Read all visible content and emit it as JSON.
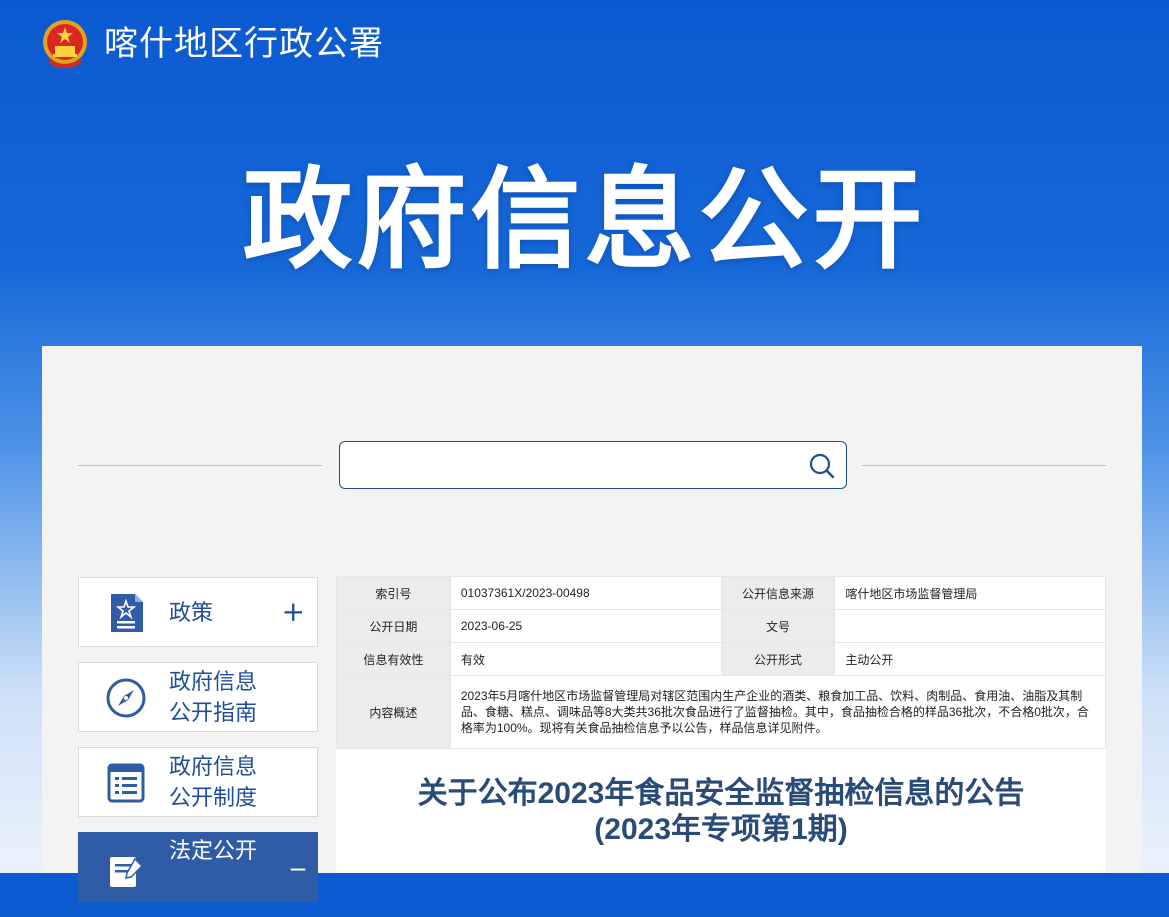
{
  "header": {
    "site_title": "喀什地区行政公署",
    "emblem_icon": "national-emblem-icon"
  },
  "hero": {
    "title": "政府信息公开"
  },
  "search": {
    "placeholder": "",
    "value": "",
    "icon": "search-icon"
  },
  "nav": {
    "items": [
      {
        "label": "政策",
        "icon": "policy-document-icon",
        "toggle": "+"
      },
      {
        "label": "政府信息\n公开指南",
        "icon": "compass-icon",
        "toggle": ""
      },
      {
        "label": "政府信息\n公开制度",
        "icon": "list-document-icon",
        "toggle": ""
      },
      {
        "label": "法定公开",
        "icon": "edit-document-icon",
        "toggle": "_"
      }
    ]
  },
  "meta": {
    "index_label": "索引号",
    "index_value": "01037361X/2023-00498",
    "source_label": "公开信息来源",
    "source_value": "喀什地区市场监督管理局",
    "date_label": "公开日期",
    "date_value": "2023-06-25",
    "docno_label": "文号",
    "docno_value": "",
    "validity_label": "信息有效性",
    "validity_value": "有效",
    "form_label": "公开形式",
    "form_value": "主动公开",
    "summary_label": "内容概述",
    "summary_value": "2023年5月喀什地区市场监督管理局对辖区范围内生产企业的酒类、粮食加工品、饮料、肉制品、食用油、油脂及其制品、食糖、糕点、调味品等8大类共36批次食品进行了监督抽检。其中，食品抽检合格的样品36批次，不合格0批次，合格率为100%。现将有关食品抽检信息予以公告，样品信息详见附件。"
  },
  "document": {
    "title_line1": "关于公布2023年食品安全监督抽检信息的公告",
    "title_line2": "(2023年专项第1期)"
  },
  "colors": {
    "primary": "#1f4e96",
    "banner": "#0b59d0",
    "active_nav": "#2f5ca4"
  }
}
